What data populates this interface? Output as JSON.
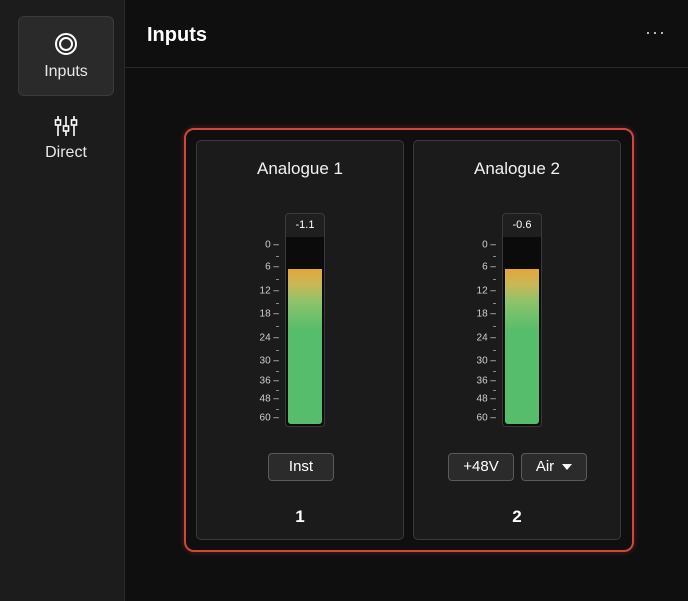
{
  "sidebar": {
    "items": [
      {
        "label": "Inputs",
        "icon": "circle-ring-icon",
        "active": true
      },
      {
        "label": "Direct",
        "icon": "mixer-sliders-icon",
        "active": false
      }
    ]
  },
  "header": {
    "title": "Inputs",
    "more_label": "···"
  },
  "colors": {
    "accent_border": "#d0463c",
    "meter_green": "#55bd6b",
    "meter_orange": "#e4a63a"
  },
  "meter_scale": [
    "0",
    "6",
    "12",
    "18",
    "24",
    "30",
    "36",
    "48",
    "60"
  ],
  "channels": [
    {
      "name": "Analogue 1",
      "peak": "-1.1",
      "level_fraction": 0.84,
      "buttons": [
        {
          "label": "Inst"
        }
      ],
      "number": "1"
    },
    {
      "name": "Analogue 2",
      "peak": "-0.6",
      "level_fraction": 0.84,
      "buttons": [
        {
          "label": "+48V"
        },
        {
          "label": "Air",
          "dropdown": true
        }
      ],
      "number": "2"
    }
  ]
}
